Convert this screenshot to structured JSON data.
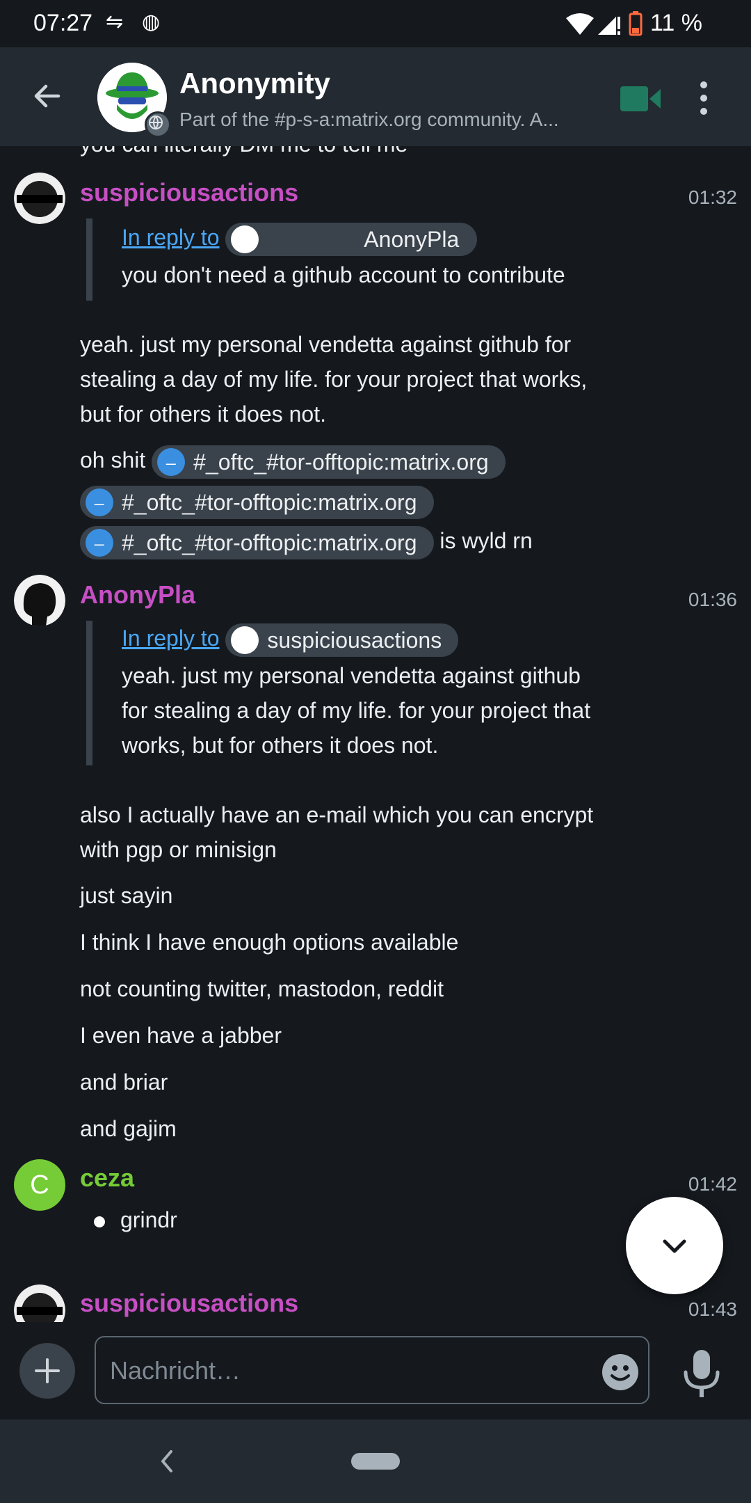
{
  "status_bar": {
    "time": "07:27",
    "battery": "11 %"
  },
  "header": {
    "title": "Anonymity",
    "topic": "Part of the #p-s-a:matrix.org community. A..."
  },
  "timeline": {
    "partial_top_line": "you can literally DM me to tell me",
    "msg1": {
      "sender": "suspiciousactions",
      "time": "01:32",
      "reply_prefix": "In reply to",
      "reply_user": "AnonyPla",
      "reply_text": "you don't need a github account to contribute",
      "body_lines": [
        "yeah. just my personal vendetta against github for",
        "stealing a day of my life. for your project that works,",
        "but for others it does not."
      ],
      "line2_prefix": "oh shit",
      "room_pill": "#_oftc_#tor-offtopic:matrix.org",
      "line2_suffix": "is wyld rn"
    },
    "msg2": {
      "sender": "AnonyPla",
      "time": "01:36",
      "reply_prefix": "In reply to",
      "reply_user": "suspiciousactions",
      "reply_lines": [
        "yeah. just my personal vendetta against github",
        "for stealing a day of my life. for your project that",
        "works, but for others it does not."
      ],
      "body_lines": [
        "also I actually have an e-mail which you can encrypt",
        "with pgp or minisign"
      ],
      "extra": [
        "just sayin",
        "I think I have enough options available",
        "not counting twitter, mastodon, reddit",
        "I even have a jabber",
        "and briar",
        "and gajim"
      ]
    },
    "msg3": {
      "sender": "ceza",
      "avatar_letter": "C",
      "time": "01:42",
      "bullet": "grindr"
    },
    "msg4": {
      "sender": "suspiciousactions",
      "time": "01:43"
    }
  },
  "composer": {
    "placeholder": "Nachricht…"
  },
  "colors": {
    "background": "#15191e",
    "toolbar": "#232a31",
    "sender_purple": "#c74fc4",
    "sender_green": "#76cc36",
    "link_blue": "#4aa7f5",
    "video_green": "#1f7a5f"
  }
}
